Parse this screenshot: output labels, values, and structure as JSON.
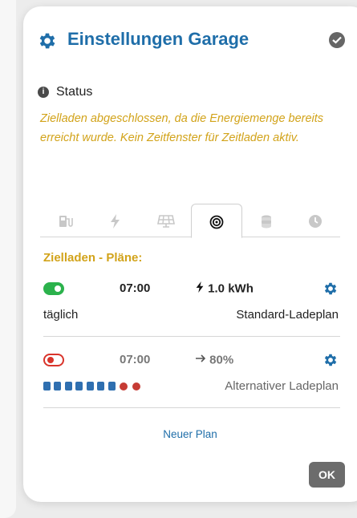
{
  "header": {
    "title": "Einstellungen Garage",
    "gear_icon": "gear-icon",
    "close_icon": "check-circle-icon"
  },
  "status": {
    "label": "Status",
    "text": "Zielladen abgeschlossen, da die Energiemenge bereits erreicht wurde. Kein Zeitfenster für Zeitladen aktiv."
  },
  "tabs": [
    {
      "icon": "charger-icon",
      "active": false
    },
    {
      "icon": "lightning-icon",
      "active": false
    },
    {
      "icon": "solar-panel-icon",
      "active": false
    },
    {
      "icon": "target-icon",
      "active": true
    },
    {
      "icon": "coins-icon",
      "active": false
    },
    {
      "icon": "clock-icon",
      "active": false
    }
  ],
  "plans": {
    "title": "Zielladen - Pläne:",
    "items": [
      {
        "enabled": true,
        "time": "07:00",
        "goal_icon": "lightning-icon",
        "goal": "1.0 kWh",
        "repeat": "täglich",
        "name": "Standard-Ladeplan"
      },
      {
        "enabled": false,
        "time": "07:00",
        "goal_icon": "arrow-right-icon",
        "goal": "80%",
        "days_on": 5,
        "days_off": 2,
        "name": "Alternativer Ladeplan"
      }
    ],
    "new_plan_label": "Neuer Plan"
  },
  "footer": {
    "ok_label": "OK"
  },
  "colors": {
    "accent": "#1f6ea9",
    "warning_text": "#d2a31a",
    "toggle_on": "#2bb24c",
    "toggle_off": "#d9342b",
    "ok_button": "#6c6c6c"
  }
}
